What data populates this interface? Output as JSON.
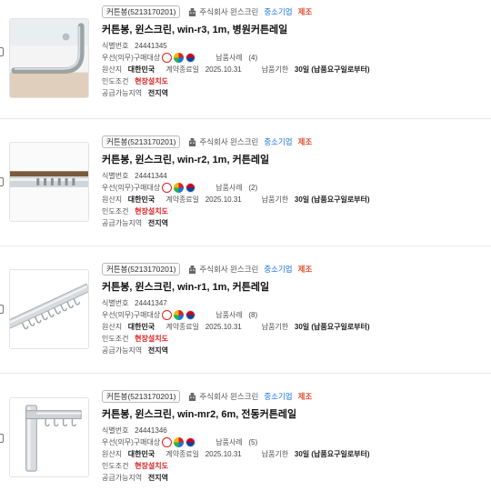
{
  "items": [
    {
      "category": "커튼봉(5213170201)",
      "company": "주식회사 윈스크린",
      "size_tag": "중소기업",
      "type_tag": "제조",
      "title": "커튼봉, 윈스크린, win-r3, 1m, 병원커튼레일",
      "id_label": "식별번호",
      "id": "24441345",
      "preferred_label": "우선(의무)구매대상",
      "cases_label": "납품사례",
      "cases": "(4)",
      "origin_label": "원산지",
      "origin": "대한민국",
      "contract_label": "계약종료일",
      "contract_end": "2025.10.31",
      "lead_label": "납품기한",
      "lead": "30일 (납품요구일로부터)",
      "delivery_label": "인도조건",
      "delivery": "현장설치도",
      "region_label": "공급가능지역",
      "region": "전지역",
      "image_icon": "curtain-rail-curved-image"
    },
    {
      "category": "커튼봉(5213170201)",
      "company": "주식회사 윈스크린",
      "size_tag": "중소기업",
      "type_tag": "제조",
      "title": "커튼봉, 윈스크린, win-r2, 1m, 커튼레일",
      "id_label": "식별번호",
      "id": "24441344",
      "preferred_label": "우선(의무)구매대상",
      "cases_label": "납품사례",
      "cases": "(2)",
      "origin_label": "원산지",
      "origin": "대한민국",
      "contract_label": "계약종료일",
      "contract_end": "2025.10.31",
      "lead_label": "납품기한",
      "lead": "30일 (납품요구일로부터)",
      "delivery_label": "인도조건",
      "delivery": "현장설치도",
      "region_label": "공급가능지역",
      "region": "전지역",
      "image_icon": "curtain-rail-straight-image"
    },
    {
      "category": "커튼봉(5213170201)",
      "company": "주식회사 윈스크린",
      "size_tag": "중소기업",
      "type_tag": "제조",
      "title": "커튼봉, 윈스크린, win-r1, 1m, 커튼레일",
      "id_label": "식별번호",
      "id": "24441347",
      "preferred_label": "우선(의무)구매대상",
      "cases_label": "납품사례",
      "cases": "(8)",
      "origin_label": "원산지",
      "origin": "대한민국",
      "contract_label": "계약종료일",
      "contract_end": "2025.10.31",
      "lead_label": "납품기한",
      "lead": "30일 (납품요구일로부터)",
      "delivery_label": "인도조건",
      "delivery": "현장설치도",
      "region_label": "공급가능지역",
      "region": "전지역",
      "image_icon": "curtain-rail-hooks-image"
    },
    {
      "category": "커튼봉(5213170201)",
      "company": "주식회사 윈스크린",
      "size_tag": "중소기업",
      "type_tag": "제조",
      "title": "커튼봉, 윈스크린, win-mr2, 6m, 전동커튼레일",
      "id_label": "식별번호",
      "id": "24441346",
      "preferred_label": "우선(의무)구매대상",
      "cases_label": "납품사례",
      "cases": "(5)",
      "origin_label": "원산지",
      "origin": "대한민국",
      "contract_label": "계약종료일",
      "contract_end": "2025.10.31",
      "lead_label": "납품기한",
      "lead": "30일 (납품요구일로부터)",
      "delivery_label": "인도조건",
      "delivery": "현장설치도",
      "region_label": "공급가능지역",
      "region": "전지역",
      "image_icon": "motorized-curtain-rail-image"
    }
  ],
  "colors": {
    "accent_blue": "#1a73e8",
    "accent_red": "#e02020",
    "manufacturer_red": "#e04a2f"
  }
}
